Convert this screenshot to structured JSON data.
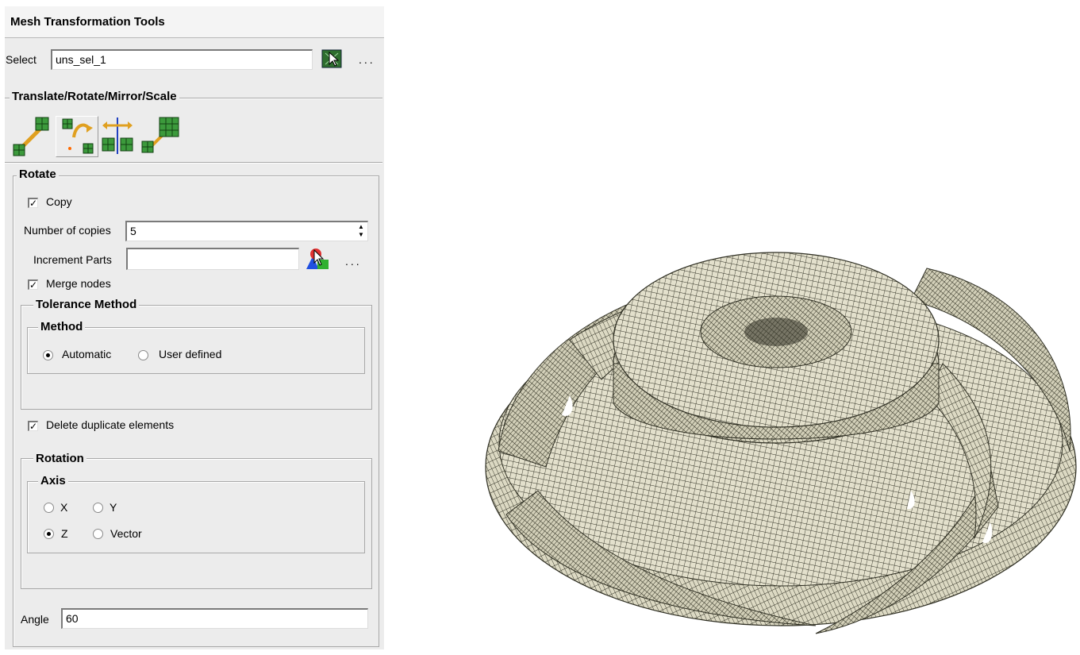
{
  "panel": {
    "title": "Mesh Transformation Tools",
    "select_label": "Select",
    "select_value": "uns_sel_1",
    "more_dots": "...",
    "section_title": "Translate/Rotate/Mirror/Scale"
  },
  "toolbar": {
    "tools": [
      "translate-icon",
      "rotate-icon",
      "mirror-icon",
      "scale-icon"
    ],
    "active": "rotate-icon"
  },
  "rotate": {
    "group_label": "Rotate",
    "copy_label": "Copy",
    "copy_checked": true,
    "num_copies_label": "Number of copies",
    "num_copies_value": "5",
    "increment_parts_label": "Increment Parts",
    "increment_parts_value": "",
    "more_dots": "...",
    "merge_nodes_label": "Merge nodes",
    "merge_nodes_checked": true,
    "tolerance_label": "Tolerance Method",
    "method_label": "Method",
    "method_options": [
      "Automatic",
      "User defined"
    ],
    "method_selected": "Automatic",
    "delete_dup_label": "Delete duplicate elements",
    "delete_dup_checked": true
  },
  "rotation": {
    "group_label": "Rotation",
    "axis_label": "Axis",
    "axis_options": [
      "X",
      "Y",
      "Z",
      "Vector"
    ],
    "axis_selected": "Z",
    "angle_label": "Angle",
    "angle_value": "60"
  },
  "colors": {
    "panel_bg": "#ececec",
    "mesh_line": "#2e2e22",
    "mesh_face": "#e3e0cc"
  }
}
